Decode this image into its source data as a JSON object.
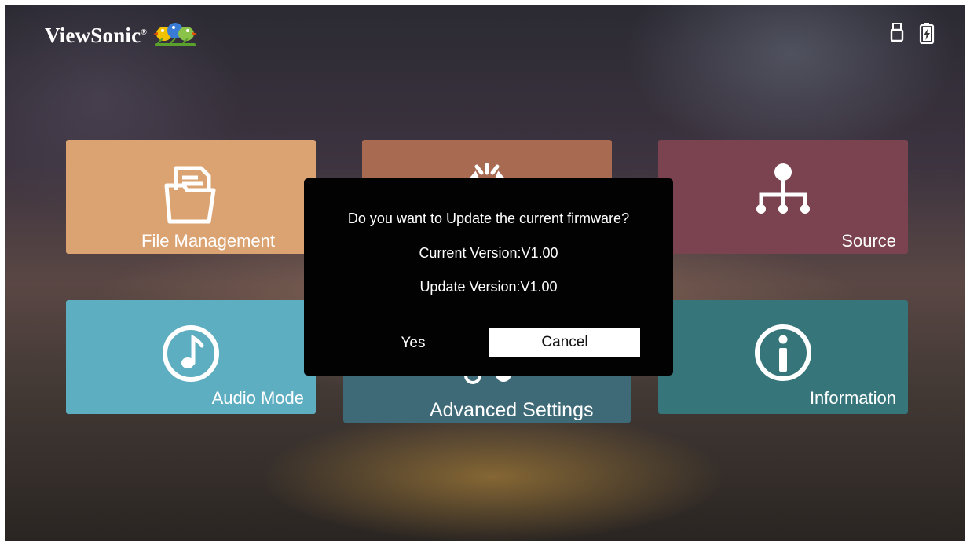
{
  "brand": {
    "name": "ViewSonic",
    "registered_mark": "®"
  },
  "status_bar": {
    "icons": [
      "usb-drive-icon",
      "battery-charging-icon"
    ]
  },
  "tiles": [
    {
      "id": "file-management",
      "label": "File Management",
      "icon": "folder-documents-icon",
      "color": "#dba372"
    },
    {
      "id": "brightness",
      "label": "",
      "icon": "brightness-icon",
      "color": "#a86a51"
    },
    {
      "id": "source",
      "label": "Source",
      "icon": "source-tree-icon",
      "color": "#7b4350"
    },
    {
      "id": "audio-mode",
      "label": "Audio Mode",
      "icon": "music-note-icon",
      "color": "#5eaec2"
    },
    {
      "id": "advanced-settings",
      "label": "Advanced Settings",
      "icon": "toggle-settings-icon",
      "color": "#3e6a78"
    },
    {
      "id": "information",
      "label": "Information",
      "icon": "info-icon",
      "color": "#36757a"
    }
  ],
  "dialog": {
    "question": "Do you want to Update the current firmware?",
    "current_version": "Current Version:V1.00",
    "update_version": "Update Version:V1.00",
    "yes_label": "Yes",
    "cancel_label": "Cancel",
    "focused_button": "Cancel"
  }
}
